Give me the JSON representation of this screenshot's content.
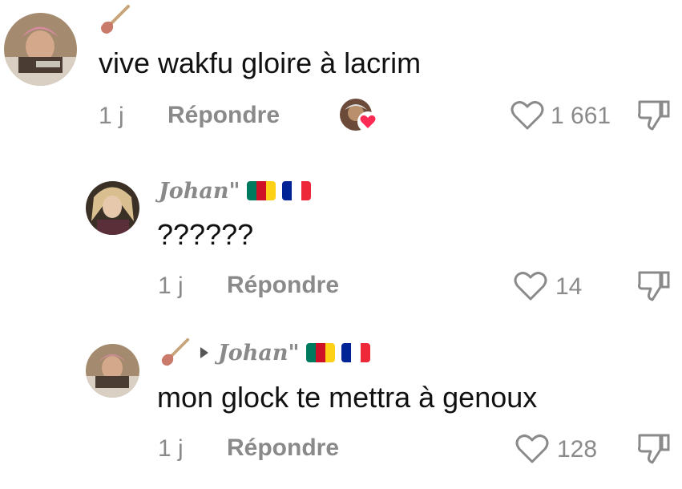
{
  "comments": [
    {
      "username": "",
      "text": "vive wakfu gloire à lacrim",
      "time": "1 j",
      "reply_label": "Répondre",
      "likes": "1 661"
    },
    {
      "username": "Johan\"",
      "text": "??????",
      "time": "1 j",
      "reply_label": "Répondre",
      "likes": "14"
    },
    {
      "username": "",
      "reply_to": "Johan\"",
      "text": "mon glock te mettra à genoux",
      "time": "1 j",
      "reply_label": "Répondre",
      "likes": "128"
    }
  ],
  "colors": {
    "text": "#111111",
    "muted": "#8a8a8a",
    "heart_badge": "#ff2b55",
    "flag_cm": [
      "#007a5e",
      "#ce1126",
      "#fcd116"
    ],
    "flag_fr": [
      "#002395",
      "#ffffff",
      "#ed2939"
    ]
  },
  "icons": [
    "plunger-icon",
    "heart-outline-icon",
    "dislike-icon",
    "creator-liked-avatar-icon",
    "reply-arrow-icon",
    "cameroon-flag-icon",
    "france-flag-icon"
  ]
}
